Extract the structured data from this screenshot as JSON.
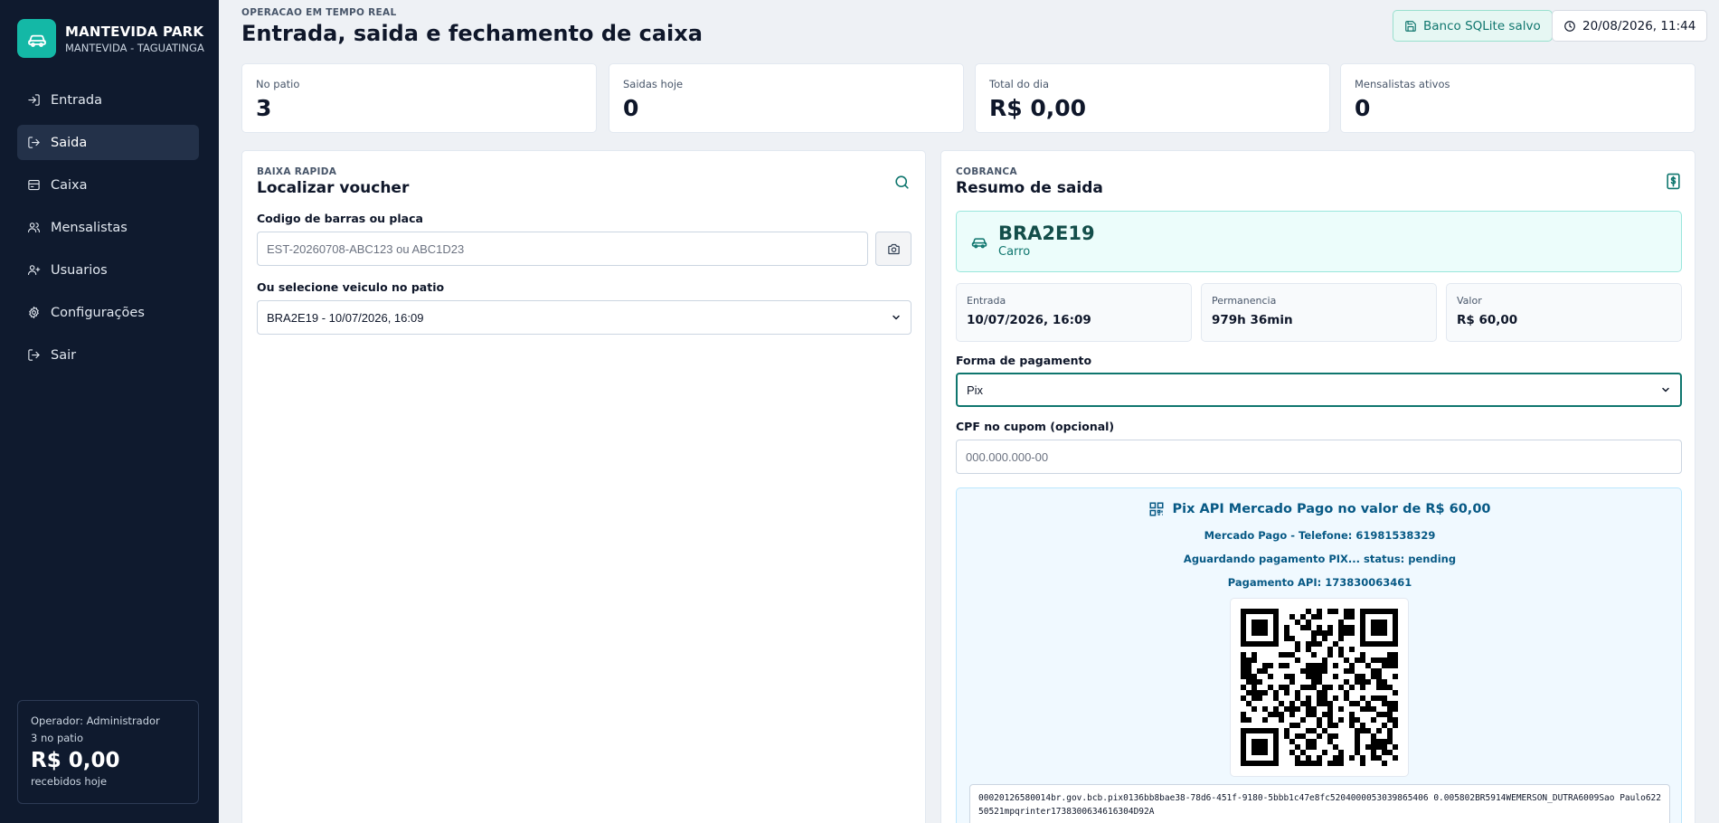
{
  "sidebar": {
    "brand_name": "MANTEVIDA PARK",
    "brand_sub": "MANTEVIDA - TAGUATINGA",
    "items": [
      {
        "label": "Entrada",
        "icon": "login-icon"
      },
      {
        "label": "Saida",
        "icon": "logout-icon",
        "active": true
      },
      {
        "label": "Caixa",
        "icon": "cash-register-icon"
      },
      {
        "label": "Mensalistas",
        "icon": "users-icon"
      },
      {
        "label": "Usuarios",
        "icon": "user-plus-icon"
      },
      {
        "label": "Configurações",
        "icon": "gear-icon"
      },
      {
        "label": "Sair",
        "icon": "logout-icon"
      }
    ],
    "operator": {
      "label": "Operador: Administrador",
      "count": "3 no patio",
      "total": "R$ 0,00",
      "caption": "recebidos hoje"
    }
  },
  "header": {
    "kicker": "OPERACAO EM TEMPO REAL",
    "title": "Entrada, saida e fechamento de caixa",
    "db_badge": "Banco SQLite salvo",
    "datetime": "20/08/2026, 11:44"
  },
  "stats": [
    {
      "label": "No patio",
      "value": "3"
    },
    {
      "label": "Saidas hoje",
      "value": "0"
    },
    {
      "label": "Total do dia",
      "value": "R$ 0,00"
    },
    {
      "label": "Mensalistas ativos",
      "value": "0"
    }
  ],
  "voucher": {
    "kicker": "BAIXA RAPIDA",
    "title": "Localizar voucher",
    "barcode_label": "Codigo de barras ou placa",
    "barcode_placeholder": "EST-20260708-ABC123 ou ABC1D23",
    "select_label": "Ou selecione veiculo no patio",
    "select_value": "BRA2E19 - 10/07/2026, 16:09"
  },
  "checkout": {
    "kicker": "COBRANCA",
    "title": "Resumo de saida",
    "plate": "BRA2E19",
    "vehicle_type": "Carro",
    "info": [
      {
        "label": "Entrada",
        "value": "10/07/2026, 16:09"
      },
      {
        "label": "Permanencia",
        "value": "979h 36min"
      },
      {
        "label": "Valor",
        "value": "R$ 60,00"
      }
    ],
    "payment_label": "Forma de pagamento",
    "payment_value": "Pix",
    "cpf_label": "CPF no cupom (opcional)",
    "cpf_placeholder": "000.000.000-00",
    "pix": {
      "title": "Pix API Mercado Pago no valor de R$ 60,00",
      "phone": "Mercado Pago - Telefone: 61981538329",
      "status": "Aguardando pagamento PIX... status: pending",
      "payment_id": "Pagamento API: 173830063461",
      "code": "00020126580014br.gov.bcb.pix0136bb8bae38-78d6-451f-9180-5bbb1c47e8fc5204000053039865406 0.005802BR5914WEMERSON_DUTRA6009Sao Paulo62250521mpqrinter1738300634616304D92A"
    }
  },
  "colors": {
    "sidebar_bg": "#0f1a2e",
    "accent": "#14b8a6",
    "pix_text": "#075985"
  }
}
